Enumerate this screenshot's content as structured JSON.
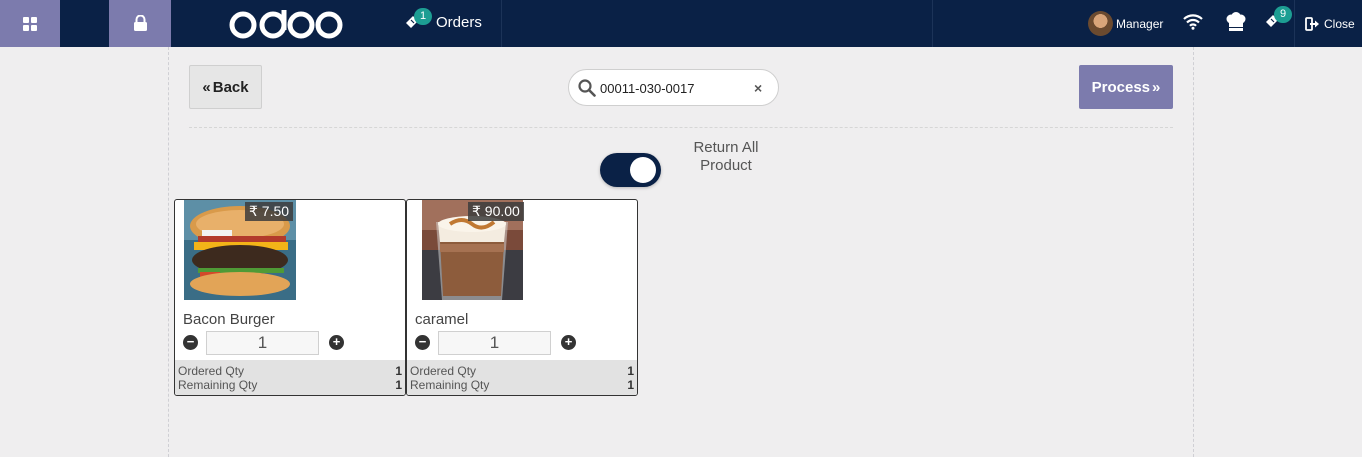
{
  "topbar": {
    "orders_badge": "1",
    "orders_label": "Orders",
    "user_name": "Manager",
    "tickets_badge": "9",
    "close_label": "Close",
    "brand_color": "#0a2146",
    "accent_color": "#7c7bad",
    "badge_color": "#1d9e93",
    "icons": [
      "apps-icon",
      "lock-icon",
      "odoo-logo",
      "ticket-icon",
      "wifi-icon",
      "chef-hat-icon",
      "ticket-icon",
      "sign-out-icon"
    ]
  },
  "toolbar": {
    "back_label": "Back",
    "process_label": "Process",
    "search_value": "00011-030-0017",
    "clear_symbol": "×"
  },
  "return_all": {
    "label_line1": "Return All",
    "label_line2": "Product",
    "enabled": true
  },
  "products": [
    {
      "name": "Bacon Burger",
      "price": "₹ 7.50",
      "qty": "1",
      "ordered_label": "Ordered Qty",
      "ordered_value": "1",
      "remaining_label": "Remaining Qty",
      "remaining_value": "1"
    },
    {
      "name": "caramel",
      "price": "₹ 90.00",
      "qty": "1",
      "ordered_label": "Ordered Qty",
      "ordered_value": "1",
      "remaining_label": "Remaining Qty",
      "remaining_value": "1"
    }
  ]
}
